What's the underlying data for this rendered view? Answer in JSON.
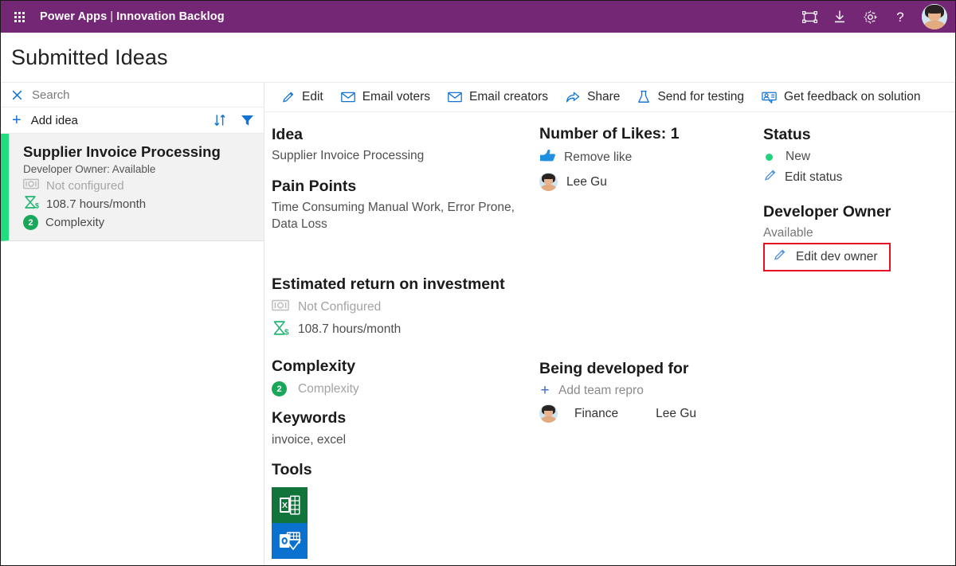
{
  "suitebar": {
    "waffle_icon": "app-launcher-waffle-icon",
    "brand_product": "Power Apps",
    "separator": "|",
    "brand_app": "Innovation Backlog",
    "icons": [
      {
        "name": "fullscreen-icon",
        "title": "Full screen"
      },
      {
        "name": "download-icon",
        "title": "Download"
      },
      {
        "name": "gear-icon",
        "title": "Settings"
      },
      {
        "name": "help-icon",
        "title": "Help"
      }
    ],
    "avatar_name": "user-avatar"
  },
  "page": {
    "title": "Submitted Ideas"
  },
  "left_pane": {
    "search": {
      "icon": "close-x-icon",
      "placeholder": "Search",
      "value": ""
    },
    "add_idea": {
      "plus": "+",
      "label": "Add idea"
    },
    "tools": [
      {
        "name": "sort-icon",
        "title": "Sort"
      },
      {
        "name": "filter-icon",
        "title": "Filter"
      }
    ],
    "ideas": [
      {
        "title": "Supplier Invoice Processing",
        "owner_line": "Developer Owner: Available",
        "roi_money": "Not configured",
        "roi_hours": "108.7 hours/month",
        "complexity_badge": "2",
        "complexity_label": "Complexity",
        "accent_color": "#21dd7e",
        "selected": true
      }
    ]
  },
  "command_bar": [
    {
      "label": "Edit",
      "icon": "pencil-icon"
    },
    {
      "label": "Email voters",
      "icon": "envelope-icon"
    },
    {
      "label": "Email creators",
      "icon": "envelope-icon"
    },
    {
      "label": "Share",
      "icon": "share-icon"
    },
    {
      "label": "Send for testing",
      "icon": "flask-icon"
    },
    {
      "label": "Get feedback on solution",
      "icon": "feedback-person-icon"
    }
  ],
  "detail": {
    "idea": {
      "heading": "Idea",
      "value": "Supplier Invoice Processing"
    },
    "pain_points": {
      "heading": "Pain Points",
      "value": "Time Consuming Manual Work, Error Prone, Data Loss"
    },
    "roi": {
      "heading": "Estimated return on investment",
      "money_icon": "money-bill-icon",
      "money_value": "Not Configured",
      "hours_icon": "hourglass-dollar-icon",
      "hours_value": "108.7 hours/month"
    },
    "complexity": {
      "heading": "Complexity",
      "badge": "2",
      "label": "Complexity"
    },
    "keywords": {
      "heading": "Keywords",
      "value": "invoice, excel"
    },
    "tools": {
      "heading": "Tools",
      "items": [
        {
          "name": "excel-icon",
          "color": "#11743a",
          "label": "Excel"
        },
        {
          "name": "outlook-icon",
          "color": "#0a71ce",
          "label": "Outlook"
        }
      ]
    },
    "likes": {
      "heading": "Number of Likes: 1",
      "action_icon": "thumbs-up-icon",
      "action_label": "Remove like",
      "voters": [
        {
          "name": "Lee Gu"
        }
      ]
    },
    "being_developed": {
      "heading": "Being developed for",
      "add_plus": "+",
      "add_label": "Add team repro",
      "rows": [
        {
          "team": "Finance",
          "person": "Lee Gu"
        }
      ]
    },
    "status": {
      "heading": "Status",
      "value": "New",
      "dot_color": "#20d47e",
      "edit_icon": "pencil-icon",
      "edit_label": "Edit status"
    },
    "developer_owner": {
      "heading": "Developer Owner",
      "value": "Available",
      "edit_icon": "pencil-icon",
      "edit_label": "Edit dev owner",
      "highlight_color": "#e81123"
    }
  }
}
